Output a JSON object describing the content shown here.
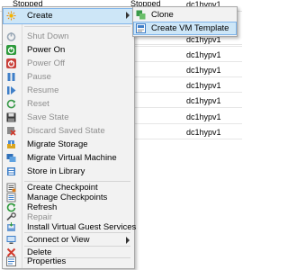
{
  "table": {
    "rows": [
      {
        "state": "Stopped",
        "status2": "Stopped",
        "host": "dc1hypv1"
      },
      {
        "state": "",
        "status2": "",
        "host": "dc1hypv1"
      },
      {
        "state": "",
        "status2": "",
        "host": "dc1hypv1"
      },
      {
        "state": "",
        "status2": "",
        "host": "dc1hypv1"
      },
      {
        "state": "",
        "status2": "",
        "host": "dc1hypv1"
      },
      {
        "state": "",
        "status2": "",
        "host": "dc1hypv1"
      },
      {
        "state": "",
        "status2": "",
        "host": "dc1hypv1"
      },
      {
        "state": "",
        "status2": "",
        "host": "dc1hypv1"
      }
    ]
  },
  "menu": {
    "items": [
      {
        "label": "Create",
        "icon": "sparkle-icon",
        "enabled": true,
        "submenu": true
      },
      {
        "label": "Shut Down",
        "icon": "shutdown-icon",
        "enabled": false
      },
      {
        "label": "Power On",
        "icon": "power-on-icon",
        "enabled": true
      },
      {
        "label": "Power Off",
        "icon": "power-off-icon",
        "enabled": false
      },
      {
        "label": "Pause",
        "icon": "pause-icon",
        "enabled": false
      },
      {
        "label": "Resume",
        "icon": "resume-icon",
        "enabled": false
      },
      {
        "label": "Reset",
        "icon": "reset-icon",
        "enabled": false
      },
      {
        "label": "Save State",
        "icon": "save-icon",
        "enabled": false
      },
      {
        "label": "Discard Saved State",
        "icon": "discard-icon",
        "enabled": false
      },
      {
        "label": "Migrate Storage",
        "icon": "migrate-storage-icon",
        "enabled": true
      },
      {
        "label": "Migrate Virtual Machine",
        "icon": "migrate-vm-icon",
        "enabled": true
      },
      {
        "label": "Store in Library",
        "icon": "library-icon",
        "enabled": true
      },
      {
        "label": "Create Checkpoint",
        "icon": "checkpoint-icon",
        "enabled": true
      },
      {
        "label": "Manage Checkpoints",
        "icon": "manage-checkpoints-icon",
        "enabled": true
      },
      {
        "label": "Refresh",
        "icon": "refresh-icon",
        "enabled": true
      },
      {
        "label": "Repair",
        "icon": "repair-icon",
        "enabled": false
      },
      {
        "label": "Install Virtual Guest Services",
        "icon": "install-icon",
        "enabled": true
      },
      {
        "label": "Connect or View",
        "icon": "connect-icon",
        "enabled": true,
        "submenu": true
      },
      {
        "label": "Delete",
        "icon": "delete-icon",
        "enabled": true
      },
      {
        "label": "Properties",
        "icon": "properties-icon",
        "enabled": true
      }
    ]
  },
  "submenu": {
    "items": [
      {
        "label": "Clone",
        "icon": "clone-icon"
      },
      {
        "label": "Create VM Template",
        "icon": "template-icon"
      }
    ]
  },
  "colors": {
    "menu_bg": "#f2f2f2",
    "highlight": "#cde6f7",
    "highlight_border": "#7eb4ea",
    "disabled_text": "#8f8f8f"
  }
}
